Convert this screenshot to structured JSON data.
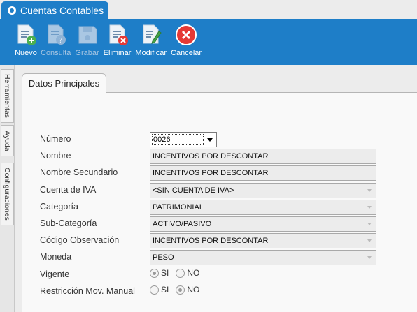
{
  "window": {
    "tab_title": "Cuentas Contables"
  },
  "toolbar": {
    "buttons": [
      {
        "label": "Nuevo",
        "icon": "document-add-icon",
        "enabled": true
      },
      {
        "label": "Consulta",
        "icon": "document-query-icon",
        "enabled": false
      },
      {
        "label": "Grabar",
        "icon": "floppy-disk-icon",
        "enabled": false
      },
      {
        "label": "Eliminar",
        "icon": "document-delete-icon",
        "enabled": true
      },
      {
        "label": "Modificar",
        "icon": "document-edit-icon",
        "enabled": true
      },
      {
        "label": "Cancelar",
        "icon": "cancel-icon",
        "enabled": true
      }
    ]
  },
  "side_tabs": [
    "Herramientas",
    "Ayuda",
    "Configuraciones"
  ],
  "content_tab": "Datos Principales",
  "form": {
    "numero": {
      "label": "Número",
      "value": "0026"
    },
    "nombre": {
      "label": "Nombre",
      "value": "INCENTIVOS POR DESCONTAR"
    },
    "nombre_secundario": {
      "label": "Nombre Secundario",
      "value": "INCENTIVOS POR DESCONTAR"
    },
    "cuenta_iva": {
      "label": "Cuenta de IVA",
      "value": "<SIN CUENTA DE IVA>"
    },
    "categoria": {
      "label": "Categoría",
      "value": "PATRIMONIAL"
    },
    "sub_categoria": {
      "label": "Sub-Categoría",
      "value": "ACTIVO/PASIVO"
    },
    "codigo_observacion": {
      "label": "Código Observación",
      "value": "INCENTIVOS POR DESCONTAR"
    },
    "moneda": {
      "label": "Moneda",
      "value": "PESO"
    },
    "vigente": {
      "label": "Vigente",
      "options": [
        "SI",
        "NO"
      ],
      "selected": "SI"
    },
    "restriccion": {
      "label": "Restricción Mov. Manual",
      "options": [
        "SI",
        "NO"
      ],
      "selected": "NO"
    }
  },
  "colors": {
    "accent": "#1e7ec8",
    "cancel_red": "#e53935"
  }
}
